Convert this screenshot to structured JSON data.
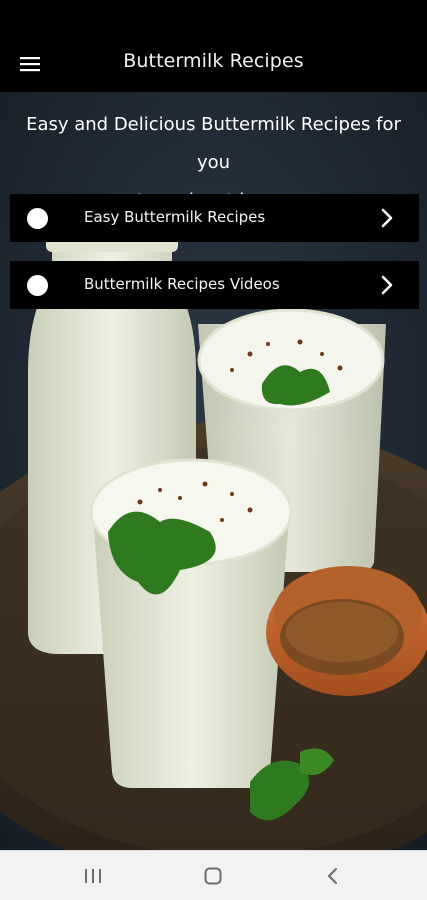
{
  "app": {
    "title": "Buttermilk Recipes",
    "menu_icon": "hamburger-menu-icon"
  },
  "headline": {
    "line1": "Easy and Delicious Buttermilk Recipes for you",
    "line2": "to make at home"
  },
  "menu": [
    {
      "label": "Easy Buttermilk Recipes",
      "icon": "circle-bullet-icon",
      "action_icon": "chevron-right-icon"
    },
    {
      "label": "Buttermilk Recipes Videos",
      "icon": "circle-bullet-icon",
      "action_icon": "chevron-right-icon"
    }
  ],
  "system_nav": {
    "recents_icon": "recents-icon",
    "home_icon": "home-icon",
    "back_icon": "back-icon"
  },
  "colors": {
    "appbar": "#000000",
    "card": "#000000",
    "text": "#ffffff",
    "navbar": "#f2f2f2"
  }
}
